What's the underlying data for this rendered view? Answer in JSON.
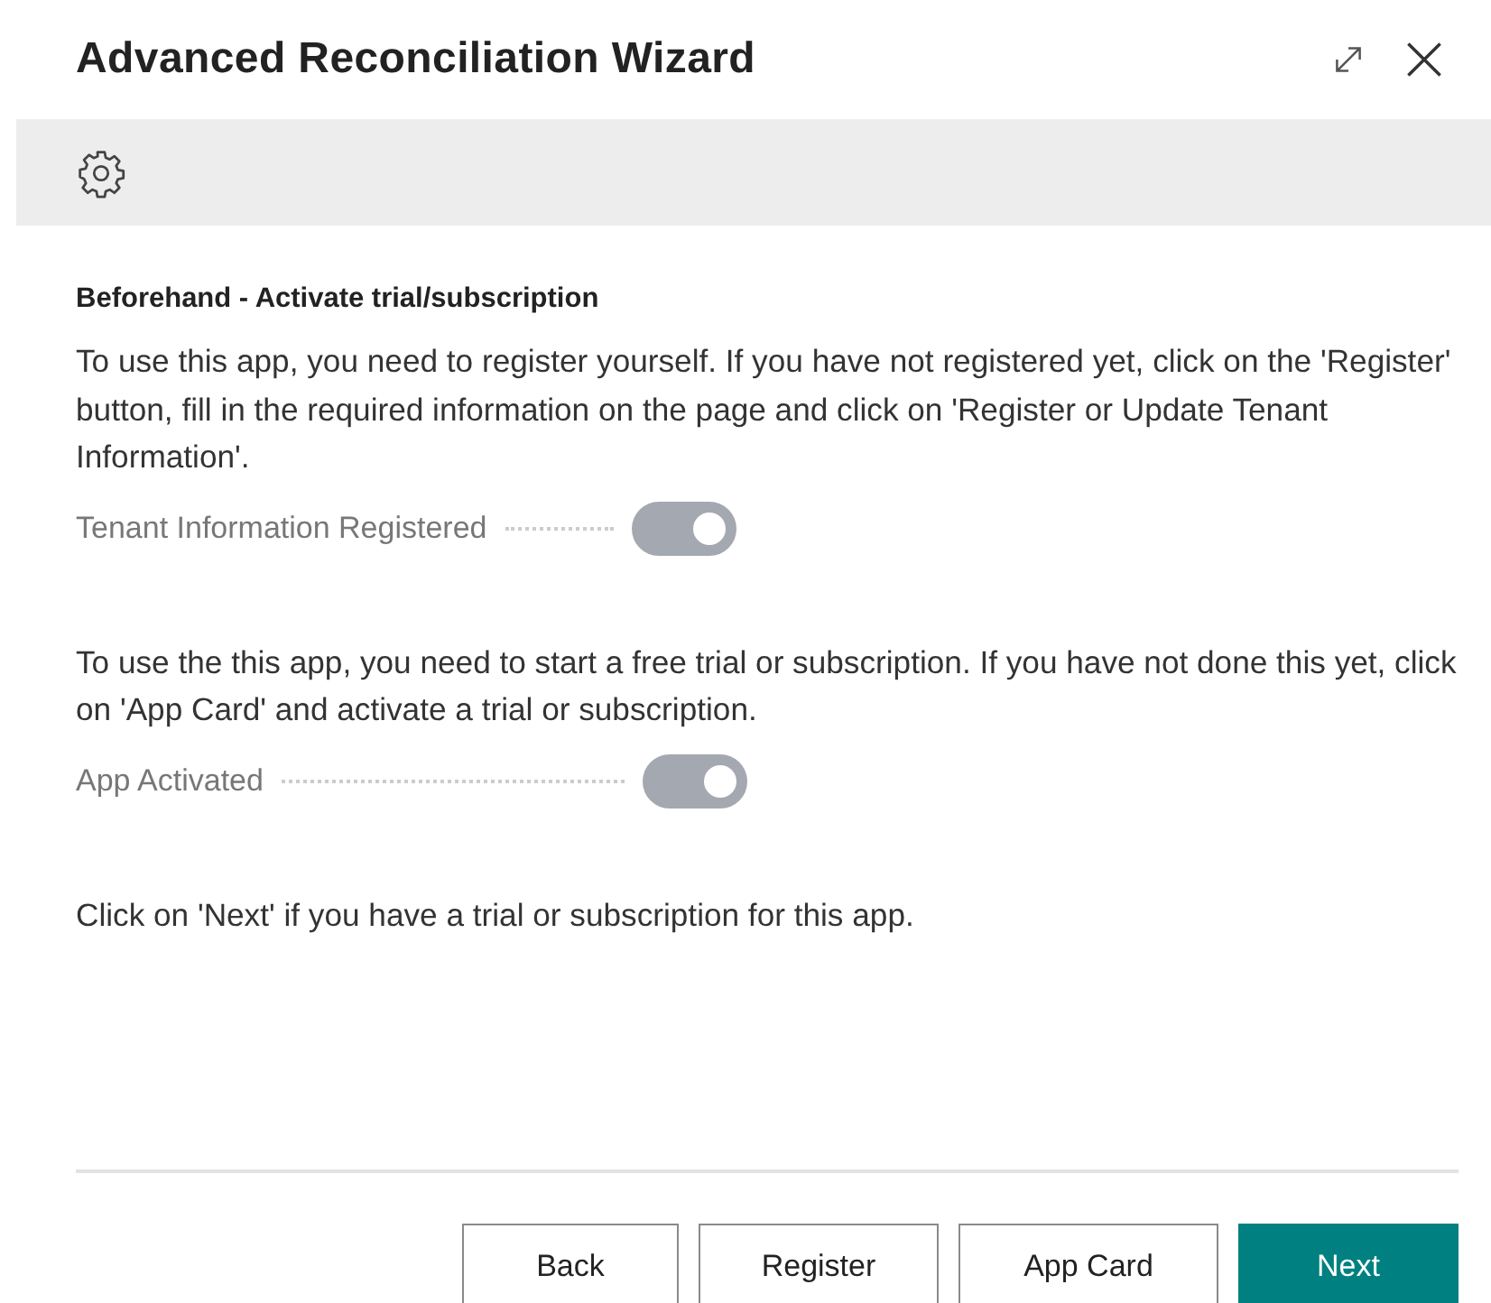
{
  "window": {
    "title": "Advanced Reconciliation Wizard"
  },
  "section": {
    "heading": "Beforehand - Activate trial/subscription"
  },
  "blocks": [
    {
      "kind": "text",
      "text": "To use this app, you need to register yourself. If you have not registered yet, click on the 'Register' button, fill in the required information on the page and click on 'Register or Update Tenant Information'."
    },
    {
      "kind": "toggle",
      "label": "Tenant Information Registered",
      "on": true,
      "disabled": true
    },
    {
      "kind": "text",
      "text": "To use the this app, you need to start a free trial or subscription. If you have not done this yet, click on 'App Card' and activate a trial or subscription."
    },
    {
      "kind": "toggle",
      "label": "App Activated",
      "on": true,
      "disabled": true
    },
    {
      "kind": "text",
      "text": "Click on 'Next' if you have a trial or subscription for this app."
    }
  ],
  "buttons": [
    {
      "label": "Back",
      "primary": false
    },
    {
      "label": "Register",
      "primary": false
    },
    {
      "label": "App Card",
      "primary": false
    },
    {
      "label": "Next",
      "primary": true
    }
  ]
}
